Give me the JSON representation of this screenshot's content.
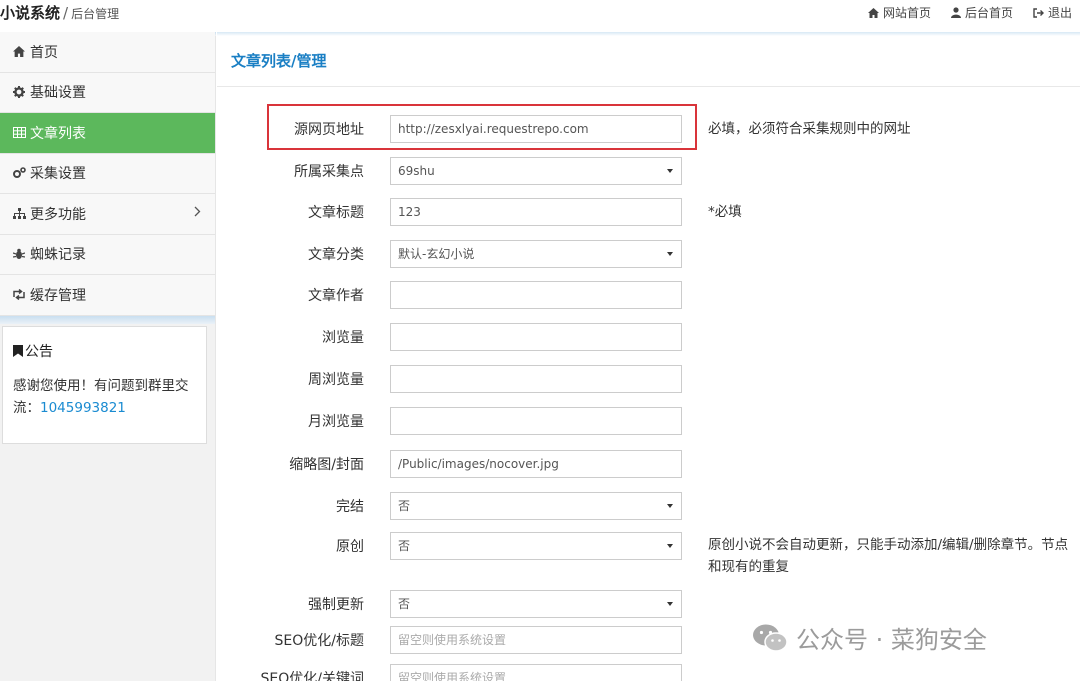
{
  "header": {
    "app_title": "小说系统",
    "separator": "/",
    "subtitle": "后台管理",
    "nav": [
      {
        "label": "网站首页",
        "icon": "home-icon"
      },
      {
        "label": "后台首页",
        "icon": "user-icon"
      },
      {
        "label": "退出",
        "icon": "logout-icon"
      }
    ]
  },
  "sidebar": {
    "items": [
      {
        "label": "首页",
        "icon": "home-icon",
        "active": false
      },
      {
        "label": "基础设置",
        "icon": "gear-icon",
        "active": false
      },
      {
        "label": "文章列表",
        "icon": "table-icon",
        "active": true
      },
      {
        "label": "采集设置",
        "icon": "gears-icon",
        "active": false
      },
      {
        "label": "更多功能",
        "icon": "sitemap-icon",
        "active": false
      },
      {
        "label": "蜘蛛记录",
        "icon": "bug-icon",
        "active": false
      },
      {
        "label": "缓存管理",
        "icon": "retweet-icon",
        "active": false
      }
    ],
    "notice": {
      "title": "公告",
      "text": "感谢您使用！有问题到群里交流：",
      "qq": "1045993821"
    }
  },
  "main": {
    "title": "文章列表/管理",
    "fields": [
      {
        "label": "源网页地址",
        "type": "text",
        "value": "http://zesxlyai.requestrepo.com",
        "help": "必填，必须符合采集规则中的网址"
      },
      {
        "label": "所属采集点",
        "type": "select",
        "value": "69shu",
        "help": ""
      },
      {
        "label": "文章标题",
        "type": "text",
        "value": "123",
        "help": "*必填"
      },
      {
        "label": "文章分类",
        "type": "select",
        "value": "默认-玄幻小说",
        "help": ""
      },
      {
        "label": "文章作者",
        "type": "text",
        "value": "",
        "help": ""
      },
      {
        "label": "浏览量",
        "type": "text",
        "value": "",
        "help": ""
      },
      {
        "label": "周浏览量",
        "type": "text",
        "value": "",
        "help": ""
      },
      {
        "label": "月浏览量",
        "type": "text",
        "value": "",
        "help": ""
      },
      {
        "label": "缩略图/封面",
        "type": "text",
        "value": "/Public/images/nocover.jpg",
        "help": ""
      },
      {
        "label": "完结",
        "type": "select",
        "value": "否",
        "help": ""
      },
      {
        "label": "原创",
        "type": "select",
        "value": "否",
        "help_line1": "原创小说不会自动更新，只能手动添加/编辑/删除章节。节点",
        "help_line2": "和现有的重复"
      },
      {
        "label": "强制更新",
        "type": "select",
        "value": "否",
        "help": ""
      },
      {
        "label": "SEO优化/标题",
        "type": "text",
        "value": "",
        "placeholder": "留空则使用系统设置",
        "help": ""
      },
      {
        "label": "SEO优化/关键词",
        "type": "text",
        "value": "",
        "placeholder": "留空则使用系统设置",
        "help": ""
      }
    ]
  },
  "watermark": {
    "text": "公众号 · 菜狗安全",
    "icon": "wechat-icon"
  }
}
